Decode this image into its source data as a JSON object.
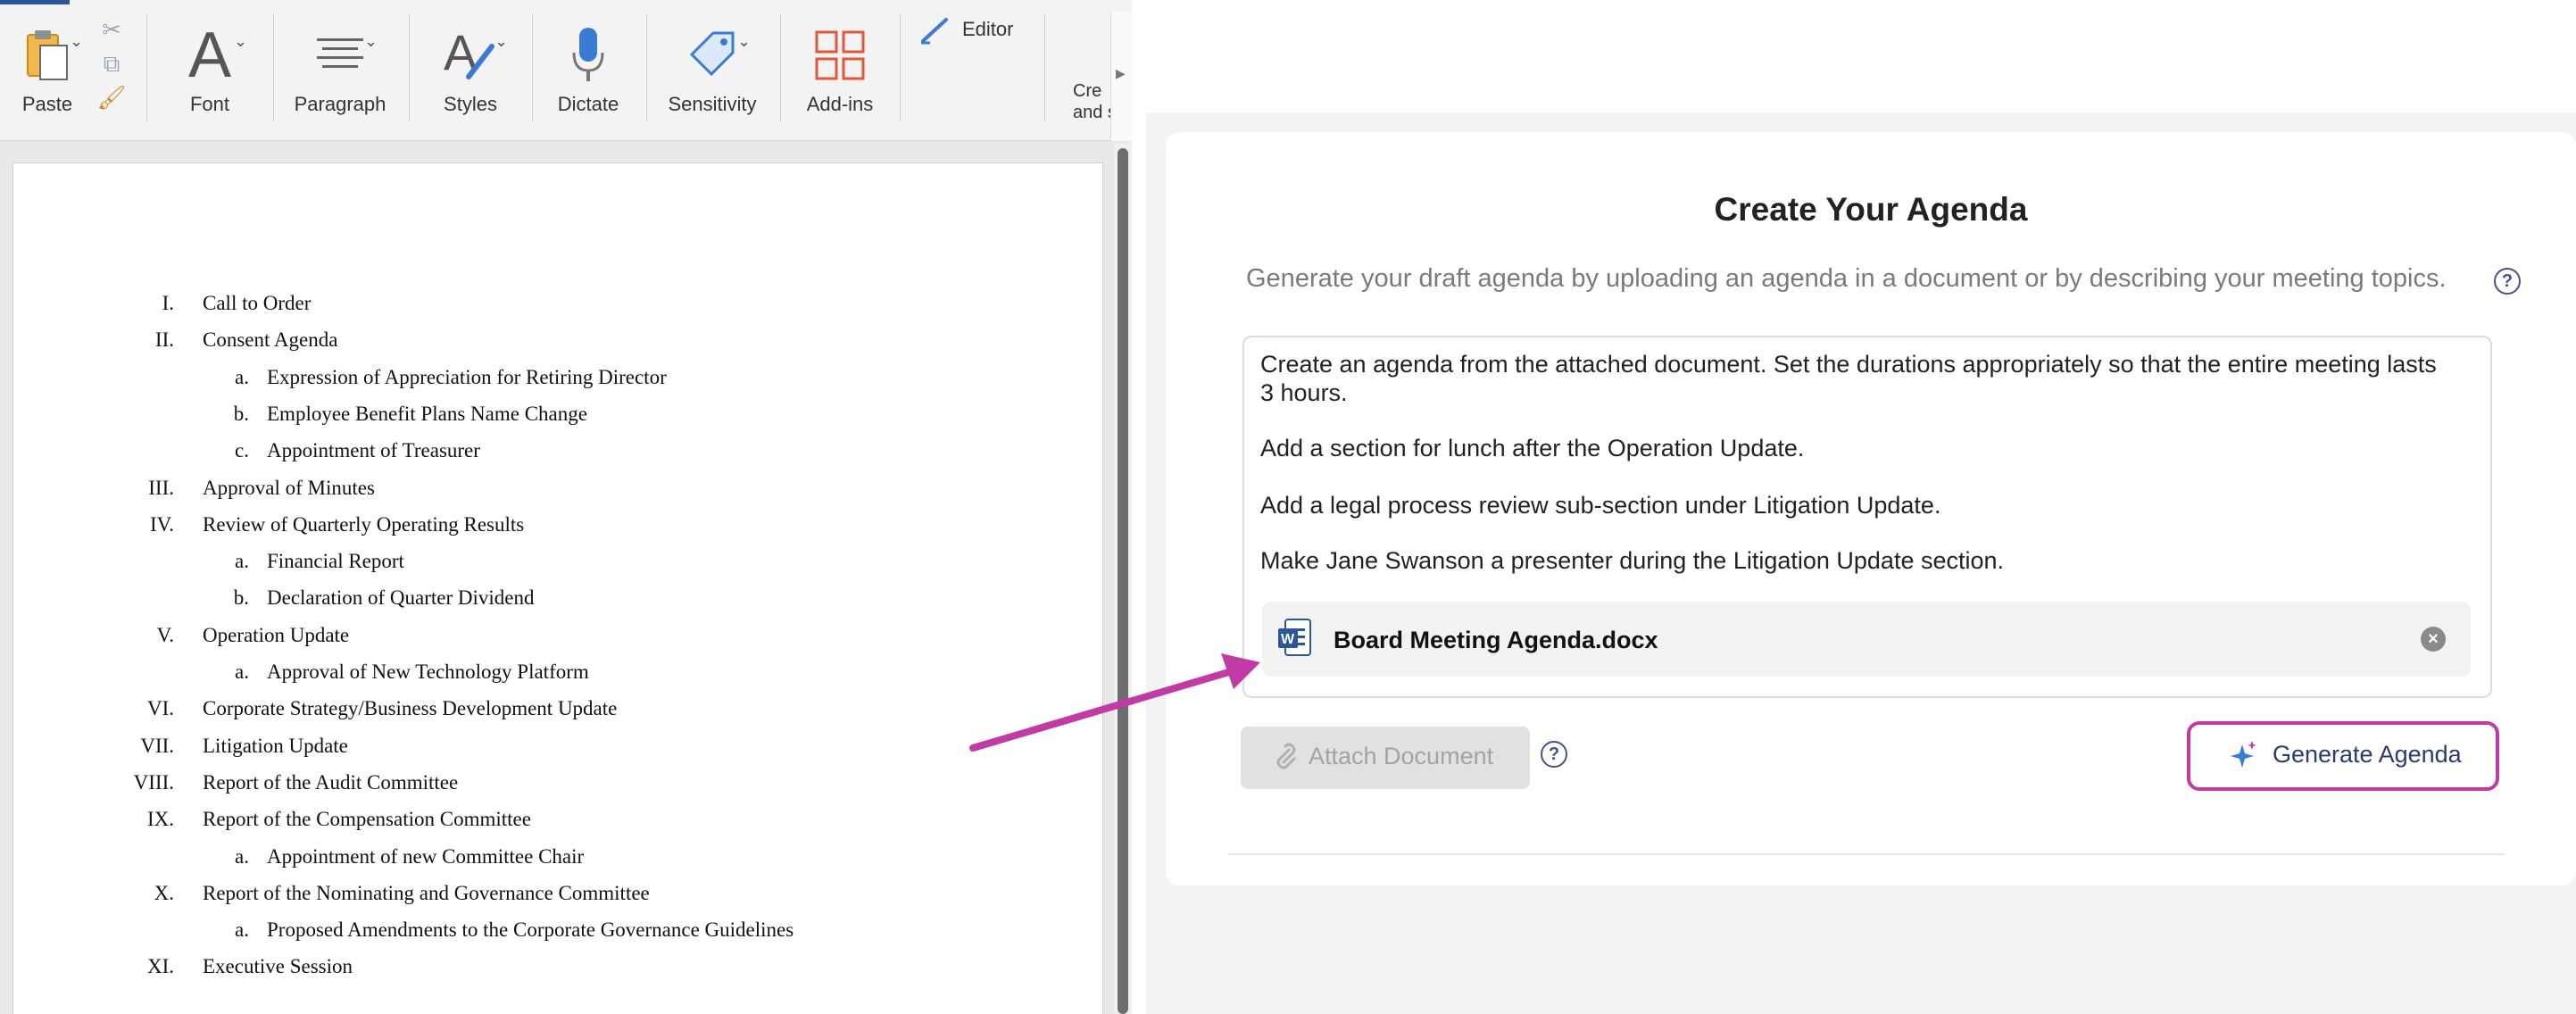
{
  "word": {
    "ribbon": {
      "paste_label": "Paste",
      "font_label": "Font",
      "paragraph_label": "Paragraph",
      "styles_label": "Styles",
      "dictate_label": "Dictate",
      "sensitivity_label": "Sensitivity",
      "addins_label": "Add-ins",
      "editor_label": "Editor",
      "create_label_line1": "Cre",
      "create_label_line2": "and s"
    },
    "document": {
      "agenda": [
        {
          "num": "I.",
          "text": "Call to Order",
          "level": 1
        },
        {
          "num": "II.",
          "text": "Consent Agenda",
          "level": 1
        },
        {
          "num": "a.",
          "text": "Expression of Appreciation for Retiring Director",
          "level": 2
        },
        {
          "num": "b.",
          "text": "Employee Benefit Plans Name Change",
          "level": 2
        },
        {
          "num": "c.",
          "text": "Appointment of Treasurer",
          "level": 2
        },
        {
          "num": "III.",
          "text": "Approval of Minutes",
          "level": 1
        },
        {
          "num": "IV.",
          "text": "Review of Quarterly Operating Results",
          "level": 1
        },
        {
          "num": "a.",
          "text": "Financial Report",
          "level": 2
        },
        {
          "num": "b.",
          "text": "Declaration of Quarter Dividend",
          "level": 2
        },
        {
          "num": "V.",
          "text": "Operation Update",
          "level": 1
        },
        {
          "num": "a.",
          "text": "Approval of New Technology Platform",
          "level": 2
        },
        {
          "num": "VI.",
          "text": "Corporate Strategy/Business Development Update",
          "level": 1
        },
        {
          "num": "VII.",
          "text": "Litigation Update",
          "level": 1
        },
        {
          "num": "VIII.",
          "text": "Report of the Audit Committee",
          "level": 1
        },
        {
          "num": "IX.",
          "text": "Report of the Compensation Committee",
          "level": 1
        },
        {
          "num": "a.",
          "text": "Appointment of new Committee Chair",
          "level": 2
        },
        {
          "num": "X.",
          "text": "Report of the Nominating and Governance Committee",
          "level": 1
        },
        {
          "num": "a.",
          "text": "Proposed Amendments to the Corporate Governance Guidelines",
          "level": 2
        },
        {
          "num": "XI.",
          "text": "Executive Session",
          "level": 1
        }
      ]
    }
  },
  "panel": {
    "title": "Create Your Agenda",
    "subtitle": "Generate your draft agenda by uploading an agenda in a document or by describing your meeting topics.",
    "prompt_lines": [
      "Create an agenda from the attached document. Set the durations appropriately so that the entire meeting lasts 3 hours.",
      "Add a section for lunch after the Operation Update.",
      "Add a legal process review sub-section under Litigation Update.",
      "Make Jane Swanson a presenter during the Litigation Update section."
    ],
    "attachment_name": "Board Meeting Agenda.docx",
    "attach_button_label": "Attach Document",
    "generate_button_label": "Generate Agenda",
    "help_glyph": "?",
    "close_glyph": "×"
  },
  "colors": {
    "highlight": "#c23aa4",
    "word_blue": "#2b579a",
    "accent_text": "#2e3a6e",
    "addins_orange": "#e2573b"
  },
  "icons": [
    "paste-icon",
    "font-icon",
    "paragraph-icon",
    "styles-icon",
    "microphone-icon",
    "sensitivity-icon",
    "addins-icon",
    "editor-pen-icon",
    "help-icon",
    "word-file-icon",
    "close-icon",
    "paperclip-icon",
    "sparkle-icon",
    "arrow-annotation"
  ]
}
